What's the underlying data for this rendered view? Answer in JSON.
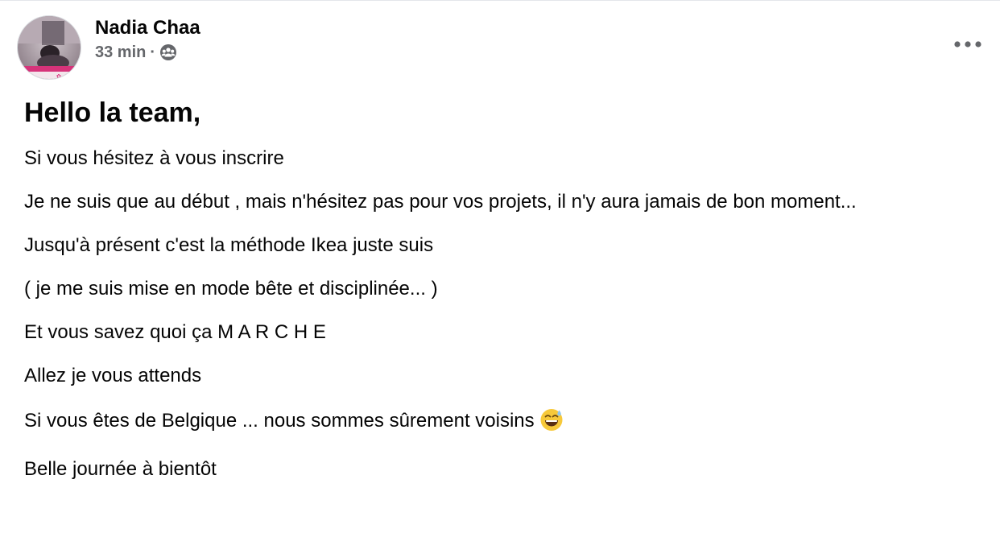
{
  "post": {
    "author": "Nadia Chaa",
    "time": "33 min",
    "separator": "·",
    "privacy_icon": "group-icon",
    "more_icon": "more-options-icon",
    "title": "Hello la team,",
    "lines": [
      "Si vous hésitez à vous inscrire",
      "Je ne suis que au début , mais n'hésitez pas pour vos projets, il n'y aura jamais de bon moment...",
      "Jusqu'à présent c'est la méthode Ikea juste suis",
      "( je me suis mise en mode bête et disciplinée... )",
      "Et vous savez quoi ça M A R C H E",
      "Allez je vous attends",
      "Si vous êtes de Belgique ... nous sommes sûrement voisins",
      "Belle journée à bientôt"
    ],
    "emoji": "grinning-face-with-sweat-icon"
  },
  "colors": {
    "text": "#050505",
    "secondary": "#65676b",
    "avatar_accent": "#d6337a"
  }
}
